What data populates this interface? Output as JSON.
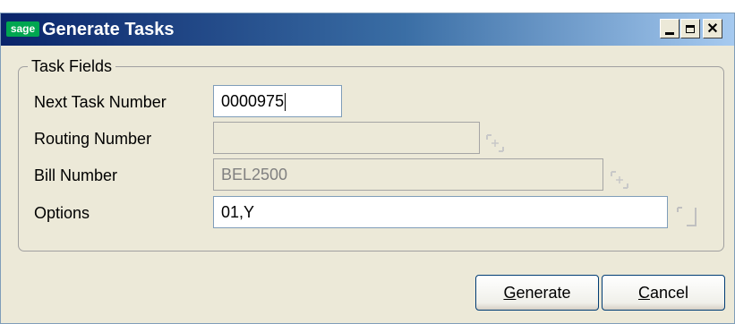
{
  "window": {
    "logo_text": "sage",
    "title": "Generate Tasks",
    "controls": {
      "minimize_icon": "minimize-icon",
      "maximize_icon": "maximize-icon",
      "close_glyph": "✕"
    }
  },
  "group": {
    "legend": "Task Fields"
  },
  "fields": {
    "next_task_number": {
      "label": "Next Task Number",
      "value": "0000975"
    },
    "routing_number": {
      "label": "Routing Number",
      "value": ""
    },
    "bill_number": {
      "label": "Bill Number",
      "value": "BEL2500"
    },
    "options": {
      "label": "Options",
      "value": "01,Y"
    }
  },
  "buttons": {
    "generate": {
      "accel": "G",
      "rest": "enerate"
    },
    "cancel": {
      "accel": "C",
      "rest": "ancel"
    }
  },
  "colors": {
    "title_start": "#0a246a",
    "title_end": "#a6caf0",
    "dialog_bg": "#ece9d8",
    "logo": "#00a650"
  }
}
